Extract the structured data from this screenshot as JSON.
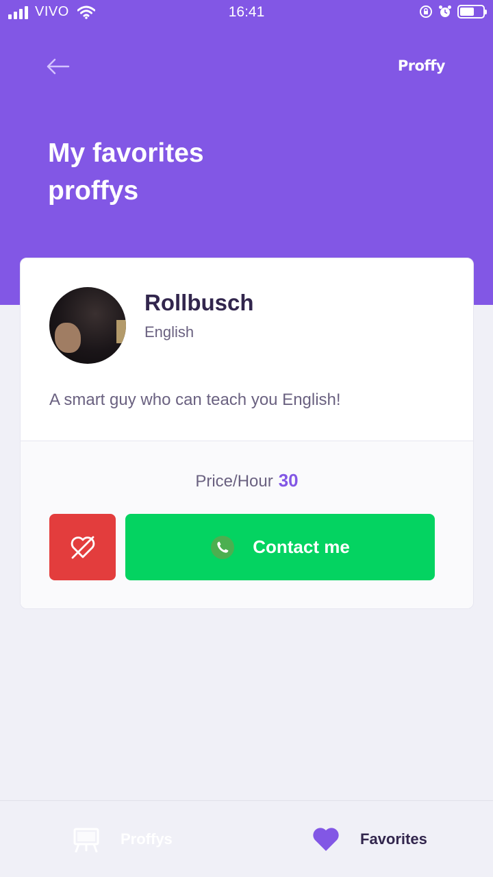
{
  "status_bar": {
    "carrier": "VIVO",
    "time": "16:41"
  },
  "header": {
    "brand": "Proffy",
    "title": "My favorites proffys",
    "background_color": "#8257E5"
  },
  "teacher_card": {
    "name": "Rollbusch",
    "subject": "English",
    "bio": "A smart guy who can teach you English!",
    "price_label": "Price/Hour",
    "price_value": "30",
    "contact_label": "Contact me",
    "unfavorite_color": "#E33D3D",
    "contact_color": "#04D361"
  },
  "tab_bar": {
    "tabs": [
      {
        "label": "Proffys",
        "icon": "easel-icon",
        "active": false
      },
      {
        "label": "Favorites",
        "icon": "heart-icon",
        "active": true
      }
    ]
  }
}
